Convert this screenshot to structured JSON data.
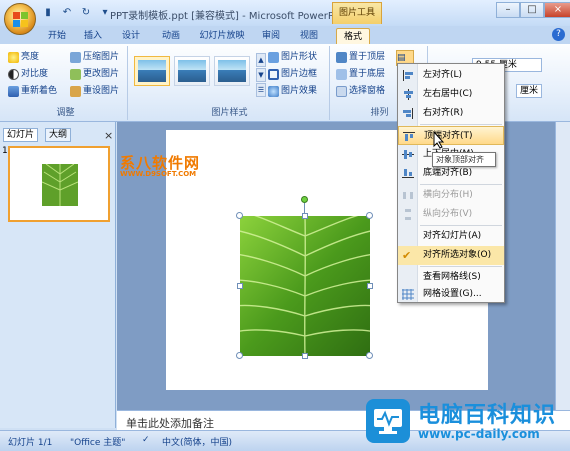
{
  "window": {
    "title": "PPT录制模板.ppt [兼容模式] - Microsoft PowerP...",
    "context_tab_group": "图片工具",
    "controls": [
      "–",
      "□",
      "×"
    ]
  },
  "quick_access": [
    "save-icon",
    "undo-icon",
    "redo-icon",
    "customize-icon"
  ],
  "tabs": [
    "开始",
    "插入",
    "设计",
    "动画",
    "幻灯片放映",
    "审阅",
    "视图",
    "格式"
  ],
  "active_tab": "格式",
  "ribbon": {
    "adjust": {
      "label": "调整",
      "items": [
        "亮度",
        "对比度",
        "重新着色",
        "压缩图片",
        "更改图片",
        "重设图片"
      ]
    },
    "picture_styles": {
      "label": "图片样式",
      "items": [
        "图片形状",
        "图片边框",
        "图片效果"
      ]
    },
    "arrange": {
      "label": "排列",
      "items": [
        "置于顶层",
        "置于底层",
        "选择窗格"
      ]
    },
    "size": {
      "height": "9.55 厘米",
      "width": "厘米"
    }
  },
  "left_pane": {
    "tabs": [
      "幻灯片",
      "大纲"
    ],
    "close": "×",
    "slide_number": "1"
  },
  "watermark": {
    "line1": "系八软件网",
    "line2": "WWW.D9SOFT.COM"
  },
  "notes_placeholder": "单击此处添加备注",
  "status": {
    "slide": "幻灯片 1/1",
    "theme": "\"Office 主题\"",
    "language": "中文(简体，中国)"
  },
  "align_menu": {
    "items": [
      {
        "label": "左对齐(L)",
        "icon": "align-left-icon",
        "state": "normal"
      },
      {
        "label": "左右居中(C)",
        "icon": "align-center-icon",
        "state": "normal"
      },
      {
        "label": "右对齐(R)",
        "icon": "align-right-icon",
        "state": "normal"
      },
      {
        "label": "顶端对齐(T)",
        "icon": "align-top-icon",
        "state": "highlighted"
      },
      {
        "label": "上下居中(M)",
        "icon": "align-middle-icon",
        "state": "normal"
      },
      {
        "label": "底端对齐(B)",
        "icon": "align-bottom-icon",
        "state": "normal"
      },
      {
        "label": "横向分布(H)",
        "icon": "distribute-horizontal-icon",
        "state": "disabled"
      },
      {
        "label": "纵向分布(V)",
        "icon": "distribute-vertical-icon",
        "state": "disabled"
      },
      {
        "label": "对齐幻灯片(A)",
        "icon": "",
        "state": "normal"
      },
      {
        "label": "对齐所选对象(O)",
        "icon": "checkmark-icon",
        "state": "checked"
      },
      {
        "label": "查看网格线(S)",
        "icon": "",
        "state": "normal"
      },
      {
        "label": "网格设置(G)...",
        "icon": "grid-icon",
        "state": "normal"
      }
    ],
    "tooltip": "对象顶部对齐"
  },
  "brand": {
    "name": "电脑百科知识",
    "url": "www.pc-daily.com"
  },
  "colors": {
    "ribbon_bg": "#e7f0fb",
    "accent_orange": "#f0a030",
    "brand_blue": "#1a8fdc"
  }
}
